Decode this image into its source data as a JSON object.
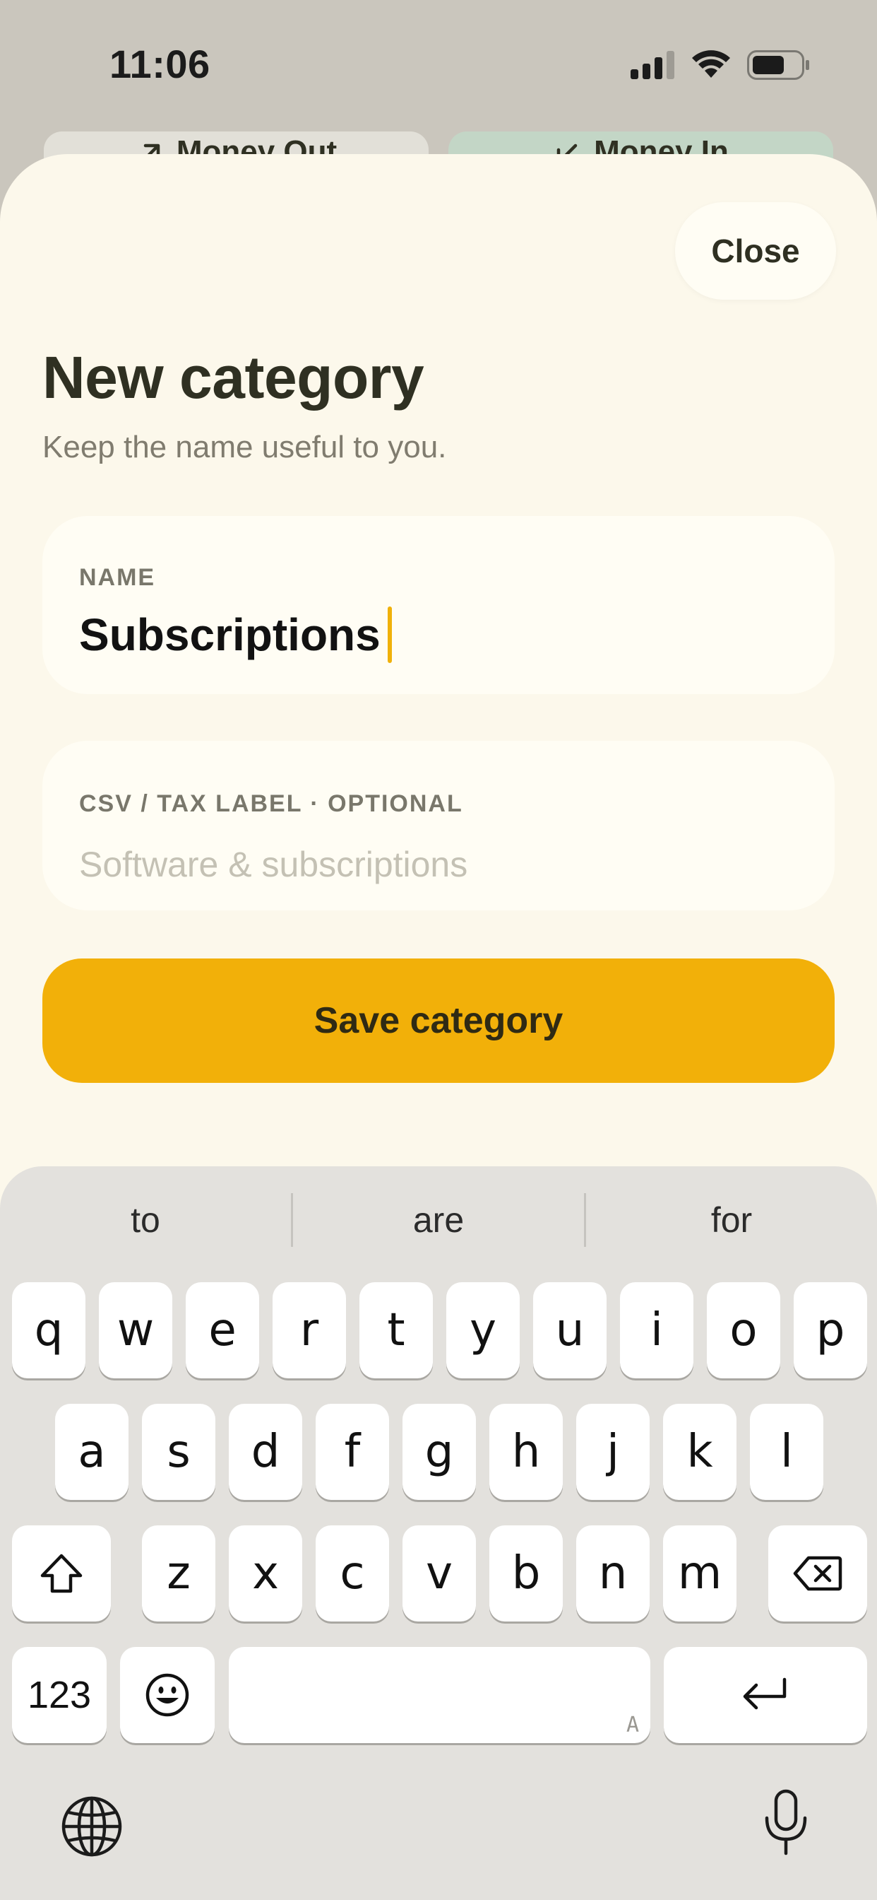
{
  "status_bar": {
    "time": "11:06",
    "icons": [
      "cellular-signal-icon",
      "wifi-icon",
      "battery-icon"
    ]
  },
  "background_tabs": [
    {
      "label": "Money Out",
      "icon": "arrow-up-right-icon"
    },
    {
      "label": "Money In",
      "icon": "arrow-down-left-icon"
    }
  ],
  "sheet": {
    "close_label": "Close",
    "title": "New category",
    "subtitle": "Keep the name useful to you.",
    "name_field": {
      "label": "NAME",
      "value": "Subscriptions"
    },
    "csv_field": {
      "label": "CSV / TAX LABEL · OPTIONAL",
      "value": "",
      "placeholder": "Software & subscriptions"
    },
    "save_label": "Save category"
  },
  "keyboard": {
    "suggestions": [
      "to",
      "are",
      "for"
    ],
    "rows": [
      [
        "q",
        "w",
        "e",
        "r",
        "t",
        "y",
        "u",
        "i",
        "o",
        "p"
      ],
      [
        "a",
        "s",
        "d",
        "f",
        "g",
        "h",
        "j",
        "k",
        "l"
      ],
      [
        "z",
        "x",
        "c",
        "v",
        "b",
        "n",
        "m"
      ]
    ],
    "numbers_label": "123",
    "space_marker": "A",
    "icons": [
      "shift-icon",
      "backspace-icon",
      "emoji-icon",
      "return-icon",
      "globe-icon",
      "microphone-icon"
    ]
  },
  "colors": {
    "accent": "#f2b009",
    "sheet_background": "#fcf8eb",
    "text_primary": "#2f3022",
    "money_in_tab": "#c3d6c6"
  }
}
